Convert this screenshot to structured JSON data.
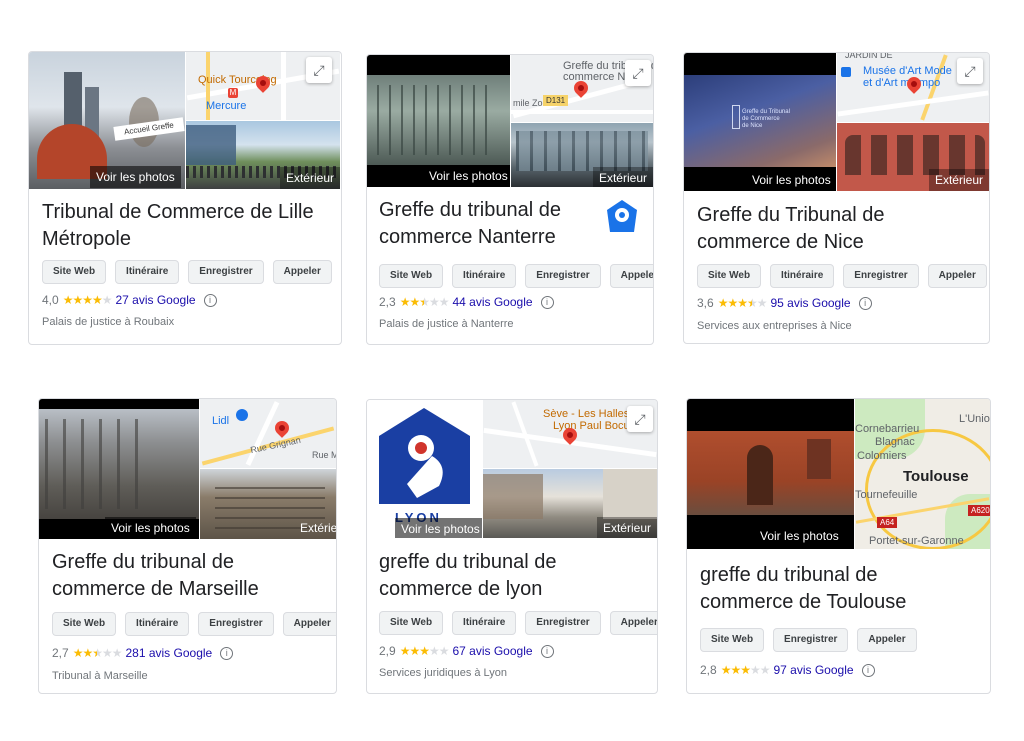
{
  "common": {
    "site_web": "Site Web",
    "itineraire": "Itinéraire",
    "enregistrer": "Enregistrer",
    "appeler": "Appeler",
    "voir_photos": "Voir les photos",
    "exterieur": "Extérieur",
    "exterieur_cut": "Extérie",
    "info_glyph": "i",
    "expand_glyph": "⤢"
  },
  "cards": [
    {
      "title_l1": "Tribunal de Commerce de Lille",
      "title_l2": "Métropole",
      "rating": "4,0",
      "stars": 4,
      "reviews": "27 avis Google",
      "category": "Palais de justice à Roubaix",
      "map": {
        "l1": "Quick Tourcoing",
        "l2": "Mercure"
      },
      "photo_sign": "Accueil Greffe"
    },
    {
      "title_l1": "Greffe du tribunal de",
      "title_l2": "commerce Nanterre",
      "rating": "2,3",
      "stars": 2.5,
      "reviews": "44 avis Google",
      "category": "Palais de justice à Nanterre",
      "map": {
        "l1": "Greffe du tribunal de",
        "l2": "commerce N",
        "l3": "mile Zola",
        "l4": "D131"
      }
    },
    {
      "title_l1": "Greffe du Tribunal de",
      "title_l2": "commerce de Nice",
      "rating": "3,6",
      "stars": 3.5,
      "reviews": "95 avis Google",
      "category": "Services aux entreprises à Nice",
      "map": {
        "l1": "Musée d'Art Mode",
        "l2": "et d'Art mtempo",
        "l3": "JARDIN DE"
      }
    },
    {
      "title_l1": "Greffe du tribunal de",
      "title_l2": "commerce de Marseille",
      "rating": "2,7",
      "stars": 2.5,
      "reviews": "281 avis Google",
      "category": "Tribunal à Marseille",
      "map": {
        "l1": "Lidl",
        "l2": "Rue Grignan",
        "l3": "Rue M"
      }
    },
    {
      "title_l1": "greffe du tribunal de",
      "title_l2": "commerce de lyon",
      "rating": "2,9",
      "stars": 3,
      "reviews": "67 avis Google",
      "category": "Services juridiques à Lyon",
      "map": {
        "l1": "Sève - Les Halles de",
        "l2": "Lyon Paul Bocuse"
      },
      "logo_text": "LYON"
    },
    {
      "title_l1": "greffe du tribunal de",
      "title_l2": "commerce de Toulouse",
      "rating": "2,8",
      "stars": 3,
      "reviews": "97 avis Google",
      "map": {
        "l1": "L'Union",
        "l2": "Cornebarrieu",
        "l3": "Blagnac",
        "l4": "Colomiers",
        "l5": "Toulouse",
        "l6": "Tournefeuille",
        "l7": "Portet-sur-Garonne",
        "l8": "A64",
        "l9": "A620"
      }
    }
  ],
  "colors": {
    "star": "#fbbc04",
    "link": "#1a0dab",
    "pin": "#ea4335",
    "logo_blue": "#1a3fa3"
  }
}
